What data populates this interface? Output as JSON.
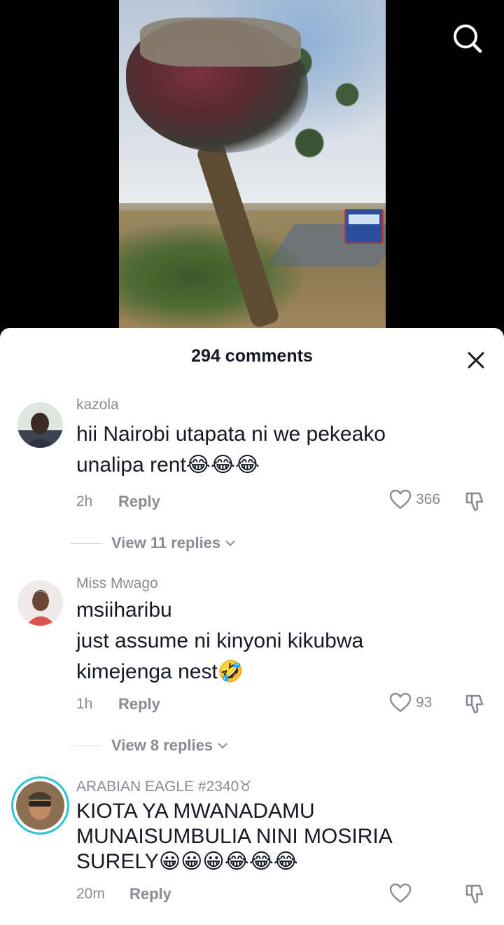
{
  "header": {
    "comment_count": "294 comments"
  },
  "icons": {
    "search": "search-icon",
    "close": "close-icon",
    "heart": "heart-icon",
    "dislike": "thumbs-down-icon",
    "chevron": "chevron-down-icon"
  },
  "comments": [
    {
      "username": "kazola",
      "text": "hii Nairobi utapata ni we pekeako\nunalipa rent😂😂😂",
      "time": "2h",
      "reply": "Reply",
      "likes": "366",
      "view_replies": "View 11 replies"
    },
    {
      "username": "Miss Mwago",
      "text": "msiiharibu\njust assume ni kinyoni kikubwa\nkimejenga nest🤣",
      "time": "1h",
      "reply": "Reply",
      "likes": "93",
      "view_replies": "View 8 replies"
    },
    {
      "username": "ARABIAN EAGLE #2340♉",
      "text": "KIOTA YA MWANADAMU\nMUNAISUMBULIA NINI MOSIRIA\nSURELY😀😀😀😂😂😂",
      "time": "20m",
      "reply": "Reply",
      "likes": ""
    }
  ]
}
